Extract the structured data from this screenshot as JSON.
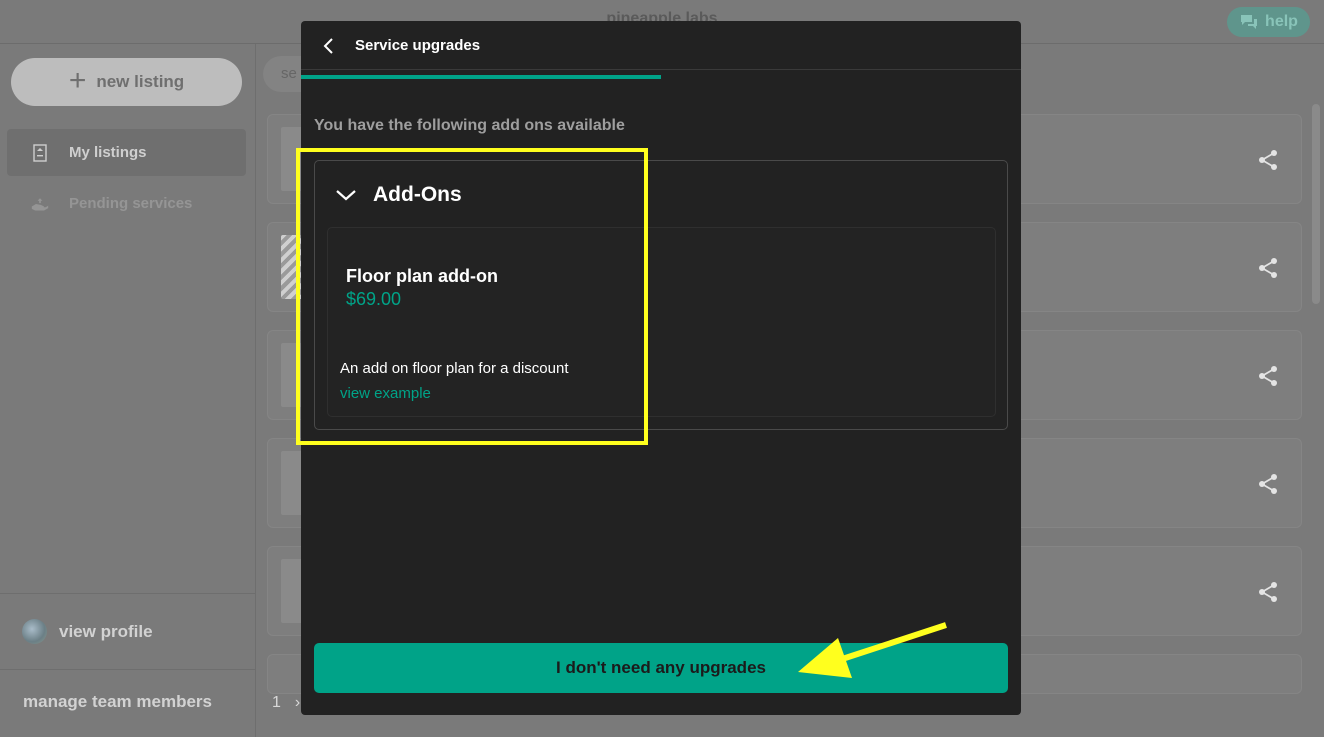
{
  "app": {
    "brand": "pineapple labs",
    "help_label": "help"
  },
  "sidebar": {
    "new_listing_label": "new listing",
    "items": [
      {
        "label": "My listings",
        "active": true
      },
      {
        "label": "Pending services",
        "active": false
      }
    ],
    "profile_label": "view profile",
    "manage_team_label": "manage team members"
  },
  "main": {
    "search_placeholder": "se",
    "listing_count": 5,
    "pagination": {
      "current_page": "1",
      "next_symbol": "›"
    }
  },
  "modal": {
    "title": "Service upgrades",
    "progress": 0.5,
    "subtitle": "You have the following add ons available",
    "section_title": "Add-Ons",
    "addon": {
      "name": "Floor plan add-on",
      "price": "$69.00",
      "description": "An add on floor plan for a discount",
      "link_label": "view example"
    },
    "cta_label": "I don't need any upgrades"
  },
  "colors": {
    "accent": "#00a388",
    "modal_bg": "#222222",
    "highlight": "#ffff1e",
    "help_bg": "#5f958c"
  },
  "icons": [
    "plus-icon",
    "listing-icon",
    "hand-icon",
    "share-icon",
    "chat-icon",
    "back-icon",
    "chevron-down-icon"
  ]
}
